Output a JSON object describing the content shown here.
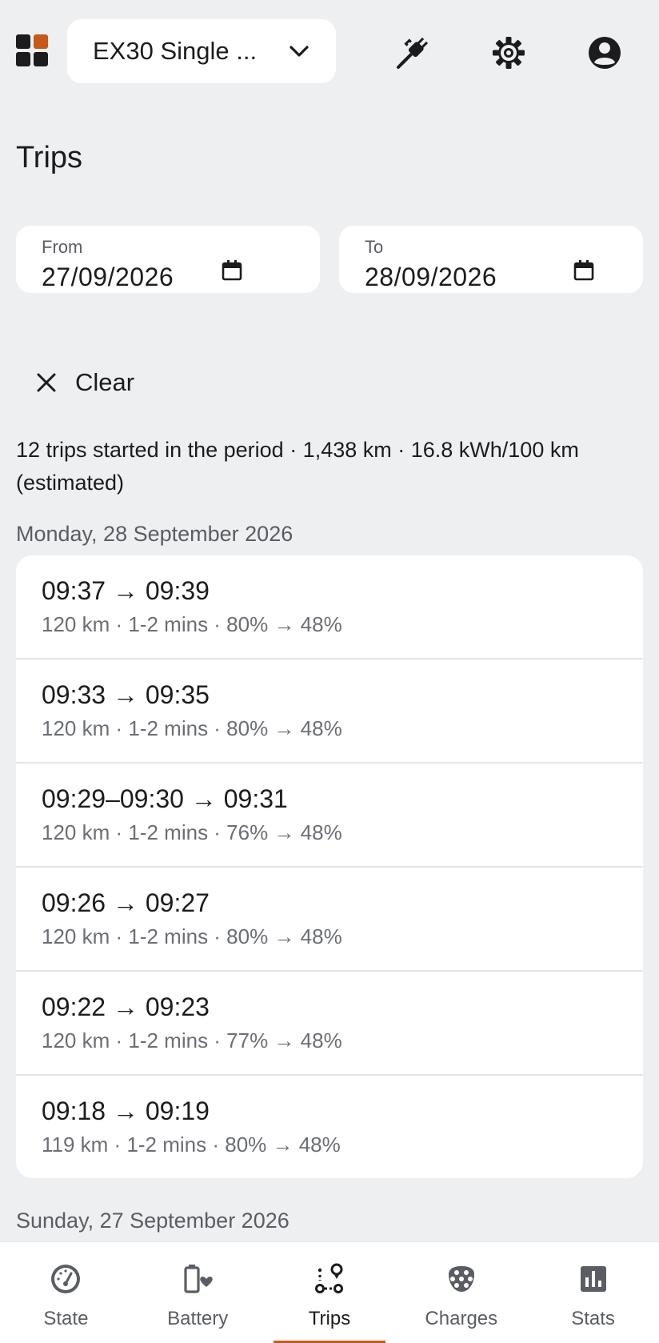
{
  "header": {
    "vehicle_name": "EX30 Single ...",
    "logo_colors": [
      "#1c1c1e",
      "#c45a1c"
    ]
  },
  "page": {
    "title": "Trips"
  },
  "filters": {
    "from_label": "From",
    "from_value": "27/09/2026",
    "to_label": "To",
    "to_value": "28/09/2026",
    "clear_label": "Clear"
  },
  "summary": "12 trips started in the period · 1,438 km · 16.8 kWh/100 km (estimated)",
  "days": [
    {
      "header": "Monday, 28 September 2026",
      "trips": [
        {
          "times": "09:37 → 09:39",
          "meta": "120 km · 1-2 mins · 80% → 48%"
        },
        {
          "times": "09:33 → 09:35",
          "meta": "120 km · 1-2 mins · 80% → 48%"
        },
        {
          "times": "09:29–09:30 → 09:31",
          "meta": "120 km · 1-2 mins · 76% → 48%"
        },
        {
          "times": "09:26 → 09:27",
          "meta": "120 km · 1-2 mins · 80% → 48%"
        },
        {
          "times": "09:22 → 09:23",
          "meta": "120 km · 1-2 mins · 77% → 48%"
        },
        {
          "times": "09:18 → 09:19",
          "meta": "119 km · 1-2 mins · 80% → 48%"
        }
      ]
    },
    {
      "header": "Sunday, 27 September 2026",
      "trips": []
    }
  ],
  "nav": {
    "items": [
      {
        "label": "State",
        "icon": "gauge-icon"
      },
      {
        "label": "Battery",
        "icon": "battery-heart-icon"
      },
      {
        "label": "Trips",
        "icon": "route-icon",
        "active": true
      },
      {
        "label": "Charges",
        "icon": "charger-plug-icon"
      },
      {
        "label": "Stats",
        "icon": "bar-chart-icon"
      }
    ],
    "active_color": "#c45a1c"
  }
}
